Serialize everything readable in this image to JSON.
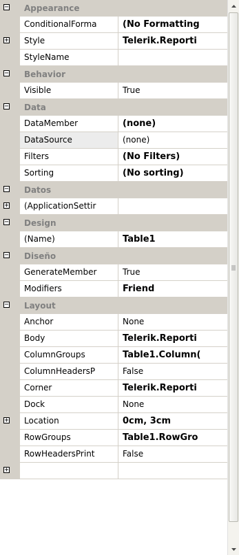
{
  "property_grid": {
    "rows": [
      {
        "kind": "category",
        "label": "Appearance",
        "expander": "minus"
      },
      {
        "kind": "prop",
        "name": "ConditionalForma",
        "value": "(No Formatting",
        "bold": true,
        "expander": "",
        "selected": false
      },
      {
        "kind": "prop",
        "name": "Style",
        "value": "Telerik.Reporti",
        "bold": true,
        "expander": "plus",
        "selected": false
      },
      {
        "kind": "prop",
        "name": "StyleName",
        "value": "",
        "bold": false,
        "expander": "",
        "selected": false
      },
      {
        "kind": "category",
        "label": "Behavior",
        "expander": "minus"
      },
      {
        "kind": "prop",
        "name": "Visible",
        "value": "True",
        "bold": false,
        "expander": "",
        "selected": false
      },
      {
        "kind": "category",
        "label": "Data",
        "expander": "minus"
      },
      {
        "kind": "prop",
        "name": "DataMember",
        "value": "(none)",
        "bold": true,
        "expander": "",
        "selected": false
      },
      {
        "kind": "prop",
        "name": "DataSource",
        "value": "(none)",
        "bold": false,
        "expander": "",
        "selected": true
      },
      {
        "kind": "prop",
        "name": "Filters",
        "value": "(No Filters)",
        "bold": true,
        "expander": "",
        "selected": false
      },
      {
        "kind": "prop",
        "name": "Sorting",
        "value": "(No sorting)",
        "bold": true,
        "expander": "",
        "selected": false
      },
      {
        "kind": "category",
        "label": "Datos",
        "expander": "minus"
      },
      {
        "kind": "prop",
        "name": "(ApplicationSettir",
        "value": "",
        "bold": false,
        "expander": "plus",
        "selected": false
      },
      {
        "kind": "category",
        "label": "Design",
        "expander": "minus"
      },
      {
        "kind": "prop",
        "name": "(Name)",
        "value": "Table1",
        "bold": true,
        "expander": "",
        "selected": false
      },
      {
        "kind": "category",
        "label": "Diseño",
        "expander": "minus"
      },
      {
        "kind": "prop",
        "name": "GenerateMember",
        "value": "True",
        "bold": false,
        "expander": "",
        "selected": false
      },
      {
        "kind": "prop",
        "name": "Modifiers",
        "value": "Friend",
        "bold": true,
        "expander": "",
        "selected": false
      },
      {
        "kind": "category",
        "label": "Layout",
        "expander": "minus"
      },
      {
        "kind": "prop",
        "name": "Anchor",
        "value": "None",
        "bold": false,
        "expander": "",
        "selected": false
      },
      {
        "kind": "prop",
        "name": "Body",
        "value": "Telerik.Reporti",
        "bold": true,
        "expander": "",
        "selected": false
      },
      {
        "kind": "prop",
        "name": "ColumnGroups",
        "value": "Table1.Column(",
        "bold": true,
        "expander": "",
        "selected": false
      },
      {
        "kind": "prop",
        "name": "ColumnHeadersP",
        "value": "False",
        "bold": false,
        "expander": "",
        "selected": false
      },
      {
        "kind": "prop",
        "name": "Corner",
        "value": "Telerik.Reporti",
        "bold": true,
        "expander": "",
        "selected": false
      },
      {
        "kind": "prop",
        "name": "Dock",
        "value": "None",
        "bold": false,
        "expander": "",
        "selected": false
      },
      {
        "kind": "prop",
        "name": "Location",
        "value": "0cm, 3cm",
        "bold": true,
        "expander": "plus",
        "selected": false
      },
      {
        "kind": "prop",
        "name": "RowGroups",
        "value": "Table1.RowGro",
        "bold": true,
        "expander": "",
        "selected": false
      },
      {
        "kind": "prop",
        "name": "RowHeadersPrint",
        "value": "False",
        "bold": false,
        "expander": "",
        "selected": false
      },
      {
        "kind": "prop",
        "name": "",
        "value": "",
        "bold": false,
        "expander": "plus",
        "selected": false
      }
    ]
  },
  "scrollbar": {
    "up_icon": "arrow-up-icon",
    "down_icon": "arrow-down-icon",
    "grip_icon": "grip-icon"
  },
  "colors": {
    "category_bg": "#d4d0c8",
    "category_text": "#808080",
    "grid_line": "#d4d0c8",
    "selected_bg": "#ececec"
  }
}
